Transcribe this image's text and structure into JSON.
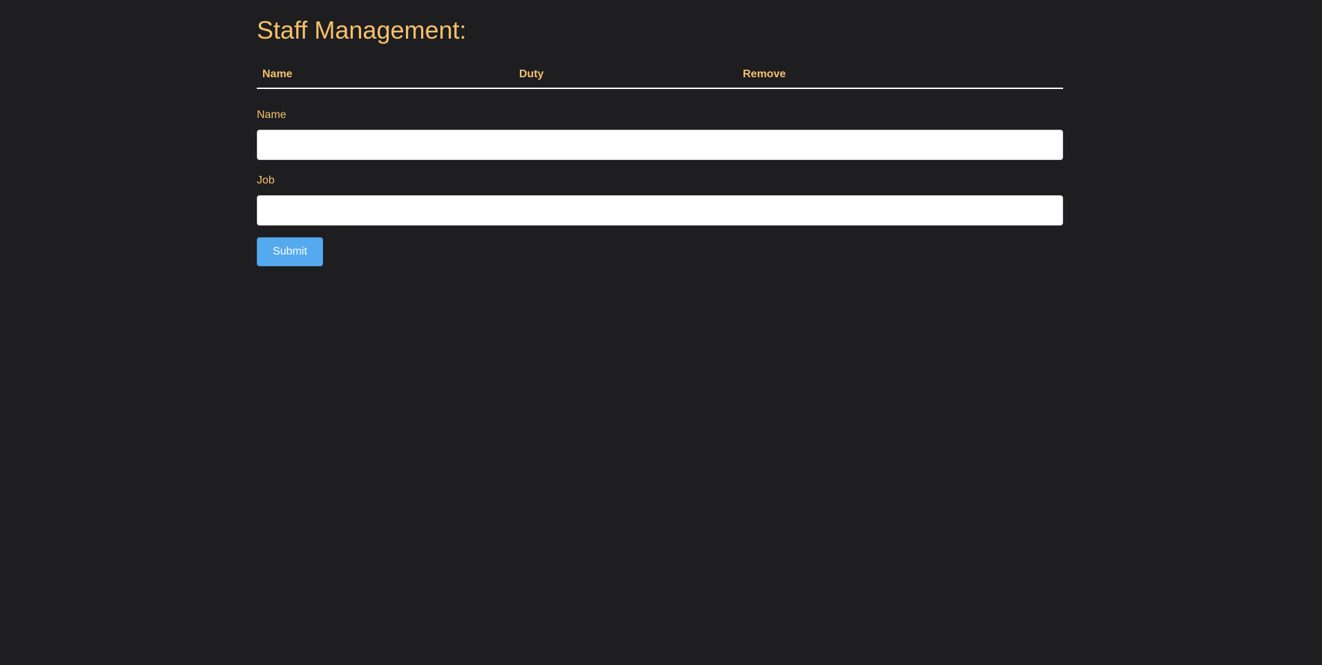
{
  "page": {
    "title": "Staff Management:"
  },
  "table": {
    "headers": {
      "name": "Name",
      "duty": "Duty",
      "remove": "Remove"
    },
    "rows": []
  },
  "form": {
    "name_label": "Name",
    "name_value": "",
    "job_label": "Job",
    "job_value": "",
    "submit_label": "Submit"
  },
  "colors": {
    "background": "#1e1e20",
    "accent_text": "#f5c16c",
    "button": "#55a9ef"
  }
}
